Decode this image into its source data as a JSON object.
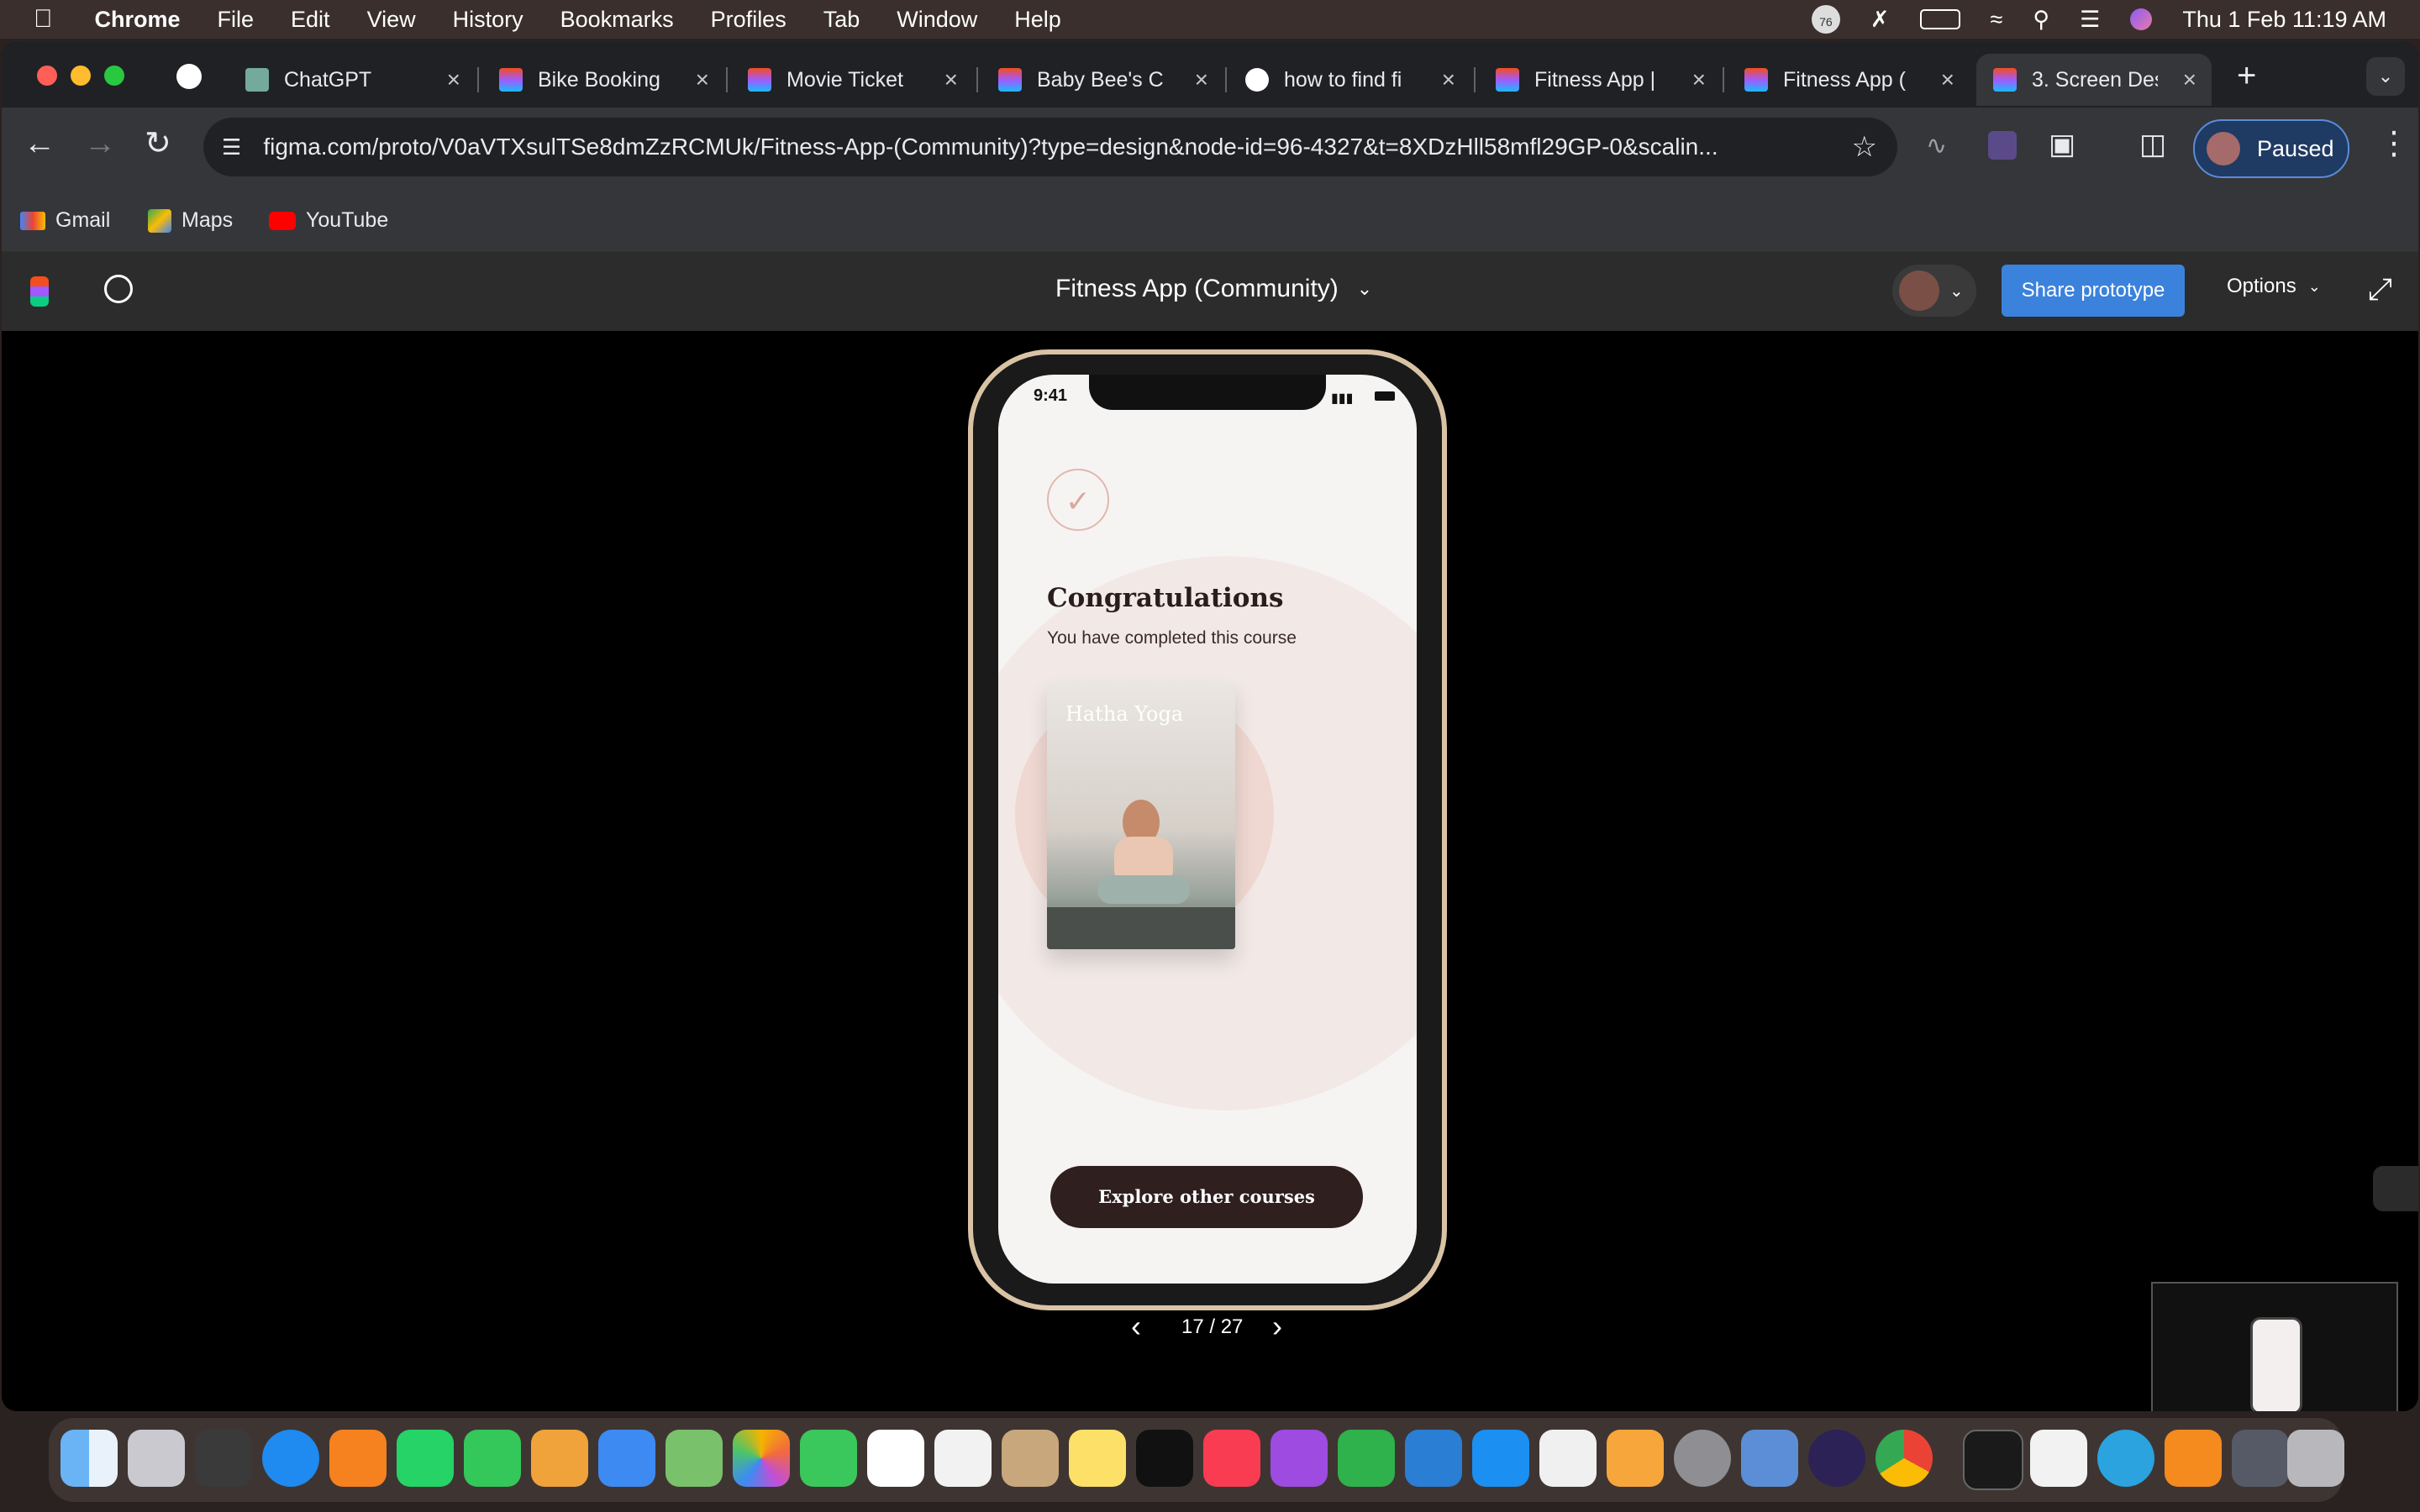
{
  "menubar": {
    "app": "Chrome",
    "items": [
      "File",
      "Edit",
      "View",
      "History",
      "Bookmarks",
      "Profiles",
      "Tab",
      "Window",
      "Help"
    ],
    "clock": "Thu 1 Feb  11:19 AM",
    "badge": "76"
  },
  "tabs": [
    {
      "title": "ChatGPT"
    },
    {
      "title": "Bike Booking"
    },
    {
      "title": "Movie Ticket"
    },
    {
      "title": "Baby Bee's C"
    },
    {
      "title": "how to find fi"
    },
    {
      "title": "Fitness App |"
    },
    {
      "title": "Fitness App ("
    },
    {
      "title": "3. Screen Des"
    }
  ],
  "address": {
    "url": "figma.com/proto/V0aVTXsulTSe8dmZzRCMUk/Fitness-App-(Community)?type=design&node-id=96-4327&t=8XDzHll58mfl29GP-0&scalin...",
    "profile_label": "Paused"
  },
  "bookmarks": [
    {
      "label": "Gmail"
    },
    {
      "label": "Maps"
    },
    {
      "label": "YouTube"
    }
  ],
  "figma": {
    "file_title": "Fitness App (Community)",
    "share_label": "Share prototype",
    "options_label": "Options",
    "page_counter": "17 / 27"
  },
  "phone": {
    "time": "9:41",
    "heading": "Congratulations",
    "subtext": "You have completed this course",
    "card_title": "Hatha Yoga",
    "button_label": "Explore other courses"
  },
  "colors": {
    "primary_button": "#2f1f1f",
    "share_button": "#3b82dc",
    "accent_ring": "#f2dbd6"
  }
}
